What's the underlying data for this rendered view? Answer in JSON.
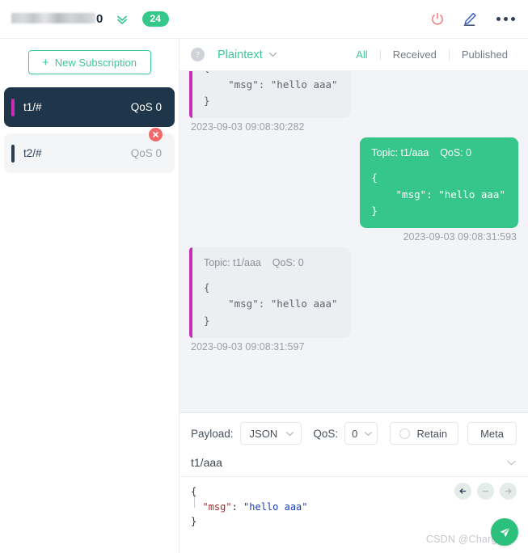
{
  "topbar": {
    "connection_name_suffix": "0",
    "connection_name_redacted": true,
    "message_count_badge": "24",
    "icons": {
      "collapse": "chevron-double-down-icon",
      "disconnect": "power-icon",
      "edit": "pencil-icon",
      "more": "more-horizontal-icon"
    },
    "colors": {
      "accent_green": "#34c88a",
      "power_red": "#f2797a",
      "pencil_blue": "#2f5bd0"
    }
  },
  "sidebar": {
    "new_subscription_label": "New Subscription",
    "new_subscription_plus": "+",
    "subscriptions": [
      {
        "topic": "t1/#",
        "qos": "QoS 0",
        "accent": "#c72fb5",
        "selected": true,
        "deletable": false
      },
      {
        "topic": "t2/#",
        "qos": "QoS 0",
        "accent": "#2b3b52",
        "selected": false,
        "deletable": true
      }
    ]
  },
  "main": {
    "help_icon_glyph": "?",
    "format_selected": "Plaintext",
    "tabs": [
      {
        "label": "All",
        "active": true
      },
      {
        "label": "Received",
        "active": false
      },
      {
        "label": "Published",
        "active": false
      }
    ]
  },
  "messages": [
    {
      "direction": "received",
      "clipped": true,
      "header": "",
      "body": "{\n    \"msg\": \"hello aaa\"\n}",
      "timestamp": "2023-09-03 09:08:30:282"
    },
    {
      "direction": "published",
      "clipped": false,
      "header": "Topic: t1/aaa    QoS: 0",
      "body": "{\n    \"msg\": \"hello aaa\"\n}",
      "timestamp": "2023-09-03 09:08:31:593"
    },
    {
      "direction": "received",
      "clipped": false,
      "header": "Topic: t1/aaa    QoS: 0",
      "body": "{\n    \"msg\": \"hello aaa\"\n}",
      "timestamp": "2023-09-03 09:08:31:597"
    }
  ],
  "publish": {
    "payload_label": "Payload:",
    "payload_value": "JSON",
    "qos_label": "QoS:",
    "qos_value": "0",
    "retain_label": "Retain",
    "retain_checked": false,
    "meta_label": "Meta",
    "topic_value": "t1/aaa",
    "editor": {
      "line1": "{",
      "key": "\"msg\"",
      "colon": ": ",
      "value": "\"hello aaa\"",
      "line3": "}"
    },
    "nav_buttons": [
      {
        "name": "arrow-left-icon",
        "enabled": true
      },
      {
        "name": "minus-icon",
        "enabled": false
      },
      {
        "name": "arrow-right-icon",
        "enabled": false
      }
    ],
    "send_icon": "send-icon"
  },
  "watermark": "CSDN @Charge3"
}
